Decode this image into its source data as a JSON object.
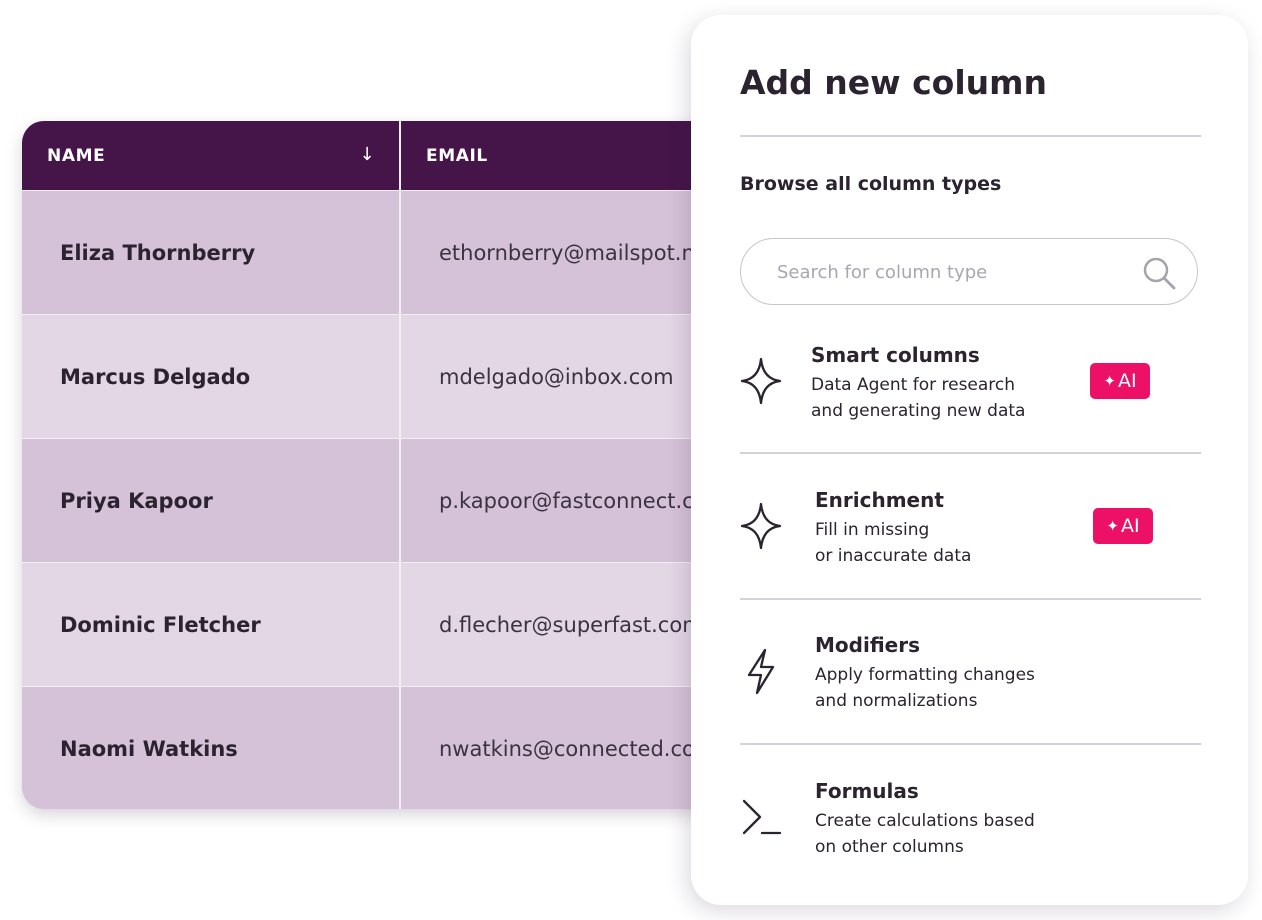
{
  "table": {
    "columns": [
      {
        "label": "NAME"
      },
      {
        "label": "EMAIL"
      }
    ],
    "sort_glyph": "↓",
    "rows": [
      {
        "name": "Eliza Thornberry",
        "email": "ethornberry@mailspot.n"
      },
      {
        "name": "Marcus Delgado",
        "email": "mdelgado@inbox.com"
      },
      {
        "name": "Priya Kapoor",
        "email": "p.kapoor@fastconnect.c"
      },
      {
        "name": "Dominic Fletcher",
        "email": "d.flecher@superfast.com"
      },
      {
        "name": "Naomi Watkins",
        "email": "nwatkins@connected.co"
      }
    ]
  },
  "panel": {
    "title": "Add new column",
    "browse_label": "Browse all column types",
    "search": {
      "placeholder": "Search for column type",
      "value": ""
    },
    "column_types": [
      {
        "title": "Smart columns",
        "desc_line1": "Data Agent for research",
        "desc_line2": "and generating new data",
        "badge": "AI",
        "icon": "sparkle-icon"
      },
      {
        "title": "Enrichment",
        "desc_line1": "Fill in missing",
        "desc_line2": "or inaccurate data",
        "badge": "AI",
        "icon": "sparkle-icon"
      },
      {
        "title": "Modifiers",
        "desc_line1": "Apply formatting changes",
        "desc_line2": "and normalizations",
        "icon": "lightning-icon"
      },
      {
        "title": "Formulas",
        "desc_line1": "Create calculations based",
        "desc_line2": "on other columns",
        "icon": "terminal-prompt-icon"
      }
    ]
  },
  "colors": {
    "header_bg": "#45154a",
    "row_odd": "#d6c2d8",
    "row_even": "#e3d6e5",
    "ai_badge": "#ec1167",
    "text_dark": "#2b2430"
  }
}
